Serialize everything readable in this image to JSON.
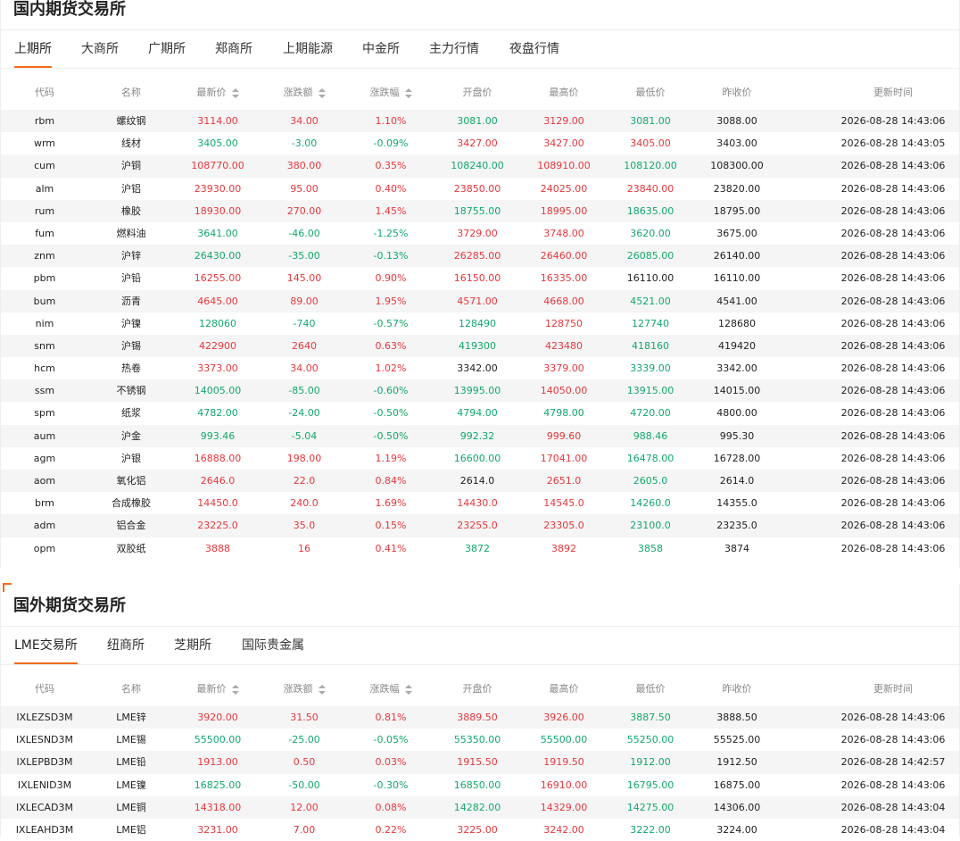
{
  "domestic": {
    "title": "国内期货交易所",
    "tabs": [
      "上期所",
      "大商所",
      "广期所",
      "郑商所",
      "上期能源",
      "中金所",
      "主力行情",
      "夜盘行情"
    ],
    "active_tab": 0,
    "headers": [
      "代码",
      "名称",
      "最新价",
      "涨跌额",
      "涨跌幅",
      "开盘价",
      "最高价",
      "最低价",
      "昨收价",
      "更新时间"
    ],
    "rows": [
      {
        "code": "rbm",
        "name": "螺纹钢",
        "last": "3114.00",
        "chg": "34.00",
        "pct": "1.10%",
        "open": "3081.00",
        "high": "3129.00",
        "low": "3081.00",
        "prev": "3088.00",
        "time": "2026-08-28 14:43:06",
        "c": [
          "up",
          "up",
          "up",
          "down",
          "up",
          "down"
        ]
      },
      {
        "code": "wrm",
        "name": "线材",
        "last": "3405.00",
        "chg": "-3.00",
        "pct": "-0.09%",
        "open": "3427.00",
        "high": "3427.00",
        "low": "3405.00",
        "prev": "3403.00",
        "time": "2026-08-28 14:43:05",
        "c": [
          "down",
          "down",
          "down",
          "up",
          "up",
          "up"
        ]
      },
      {
        "code": "cum",
        "name": "沪铜",
        "last": "108770.00",
        "chg": "380.00",
        "pct": "0.35%",
        "open": "108240.00",
        "high": "108910.00",
        "low": "108120.00",
        "prev": "108300.00",
        "time": "2026-08-28 14:43:06",
        "c": [
          "up",
          "up",
          "up",
          "down",
          "up",
          "down"
        ]
      },
      {
        "code": "alm",
        "name": "沪铝",
        "last": "23930.00",
        "chg": "95.00",
        "pct": "0.40%",
        "open": "23850.00",
        "high": "24025.00",
        "low": "23840.00",
        "prev": "23820.00",
        "time": "2026-08-28 14:43:06",
        "c": [
          "up",
          "up",
          "up",
          "up",
          "up",
          "up"
        ]
      },
      {
        "code": "rum",
        "name": "橡胶",
        "last": "18930.00",
        "chg": "270.00",
        "pct": "1.45%",
        "open": "18755.00",
        "high": "18995.00",
        "low": "18635.00",
        "prev": "18795.00",
        "time": "2026-08-28 14:43:06",
        "c": [
          "up",
          "up",
          "up",
          "down",
          "up",
          "down"
        ]
      },
      {
        "code": "fum",
        "name": "燃料油",
        "last": "3641.00",
        "chg": "-46.00",
        "pct": "-1.25%",
        "open": "3729.00",
        "high": "3748.00",
        "low": "3620.00",
        "prev": "3675.00",
        "time": "2026-08-28 14:43:06",
        "c": [
          "down",
          "down",
          "down",
          "up",
          "up",
          "down"
        ]
      },
      {
        "code": "znm",
        "name": "沪锌",
        "last": "26430.00",
        "chg": "-35.00",
        "pct": "-0.13%",
        "open": "26285.00",
        "high": "26460.00",
        "low": "26085.00",
        "prev": "26140.00",
        "time": "2026-08-28 14:43:06",
        "c": [
          "down",
          "down",
          "down",
          "up",
          "up",
          "down"
        ]
      },
      {
        "code": "pbm",
        "name": "沪铅",
        "last": "16255.00",
        "chg": "145.00",
        "pct": "0.90%",
        "open": "16150.00",
        "high": "16335.00",
        "low": "16110.00",
        "prev": "16110.00",
        "time": "2026-08-28 14:43:06",
        "c": [
          "up",
          "up",
          "up",
          "up",
          "up",
          "flat"
        ]
      },
      {
        "code": "bum",
        "name": "沥青",
        "last": "4645.00",
        "chg": "89.00",
        "pct": "1.95%",
        "open": "4571.00",
        "high": "4668.00",
        "low": "4521.00",
        "prev": "4541.00",
        "time": "2026-08-28 14:43:06",
        "c": [
          "up",
          "up",
          "up",
          "up",
          "up",
          "down"
        ]
      },
      {
        "code": "nim",
        "name": "沪镍",
        "last": "128060",
        "chg": "-740",
        "pct": "-0.57%",
        "open": "128490",
        "high": "128750",
        "low": "127740",
        "prev": "128680",
        "time": "2026-08-28 14:43:06",
        "c": [
          "down",
          "down",
          "down",
          "down",
          "up",
          "down"
        ]
      },
      {
        "code": "snm",
        "name": "沪锡",
        "last": "422900",
        "chg": "2640",
        "pct": "0.63%",
        "open": "419300",
        "high": "423480",
        "low": "418160",
        "prev": "419420",
        "time": "2026-08-28 14:43:06",
        "c": [
          "up",
          "up",
          "up",
          "down",
          "up",
          "down"
        ]
      },
      {
        "code": "hcm",
        "name": "热卷",
        "last": "3373.00",
        "chg": "34.00",
        "pct": "1.02%",
        "open": "3342.00",
        "high": "3379.00",
        "low": "3339.00",
        "prev": "3342.00",
        "time": "2026-08-28 14:43:06",
        "c": [
          "up",
          "up",
          "up",
          "flat",
          "up",
          "down"
        ]
      },
      {
        "code": "ssm",
        "name": "不锈钢",
        "last": "14005.00",
        "chg": "-85.00",
        "pct": "-0.60%",
        "open": "13995.00",
        "high": "14050.00",
        "low": "13915.00",
        "prev": "14015.00",
        "time": "2026-08-28 14:43:06",
        "c": [
          "down",
          "down",
          "down",
          "down",
          "up",
          "down"
        ]
      },
      {
        "code": "spm",
        "name": "纸浆",
        "last": "4782.00",
        "chg": "-24.00",
        "pct": "-0.50%",
        "open": "4794.00",
        "high": "4798.00",
        "low": "4720.00",
        "prev": "4800.00",
        "time": "2026-08-28 14:43:06",
        "c": [
          "down",
          "down",
          "down",
          "down",
          "down",
          "down"
        ]
      },
      {
        "code": "aum",
        "name": "沪金",
        "last": "993.46",
        "chg": "-5.04",
        "pct": "-0.50%",
        "open": "992.32",
        "high": "999.60",
        "low": "988.46",
        "prev": "995.30",
        "time": "2026-08-28 14:43:06",
        "c": [
          "down",
          "down",
          "down",
          "down",
          "up",
          "down"
        ]
      },
      {
        "code": "agm",
        "name": "沪银",
        "last": "16888.00",
        "chg": "198.00",
        "pct": "1.19%",
        "open": "16600.00",
        "high": "17041.00",
        "low": "16478.00",
        "prev": "16728.00",
        "time": "2026-08-28 14:43:06",
        "c": [
          "up",
          "up",
          "up",
          "down",
          "up",
          "down"
        ]
      },
      {
        "code": "aom",
        "name": "氧化铝",
        "last": "2646.0",
        "chg": "22.0",
        "pct": "0.84%",
        "open": "2614.0",
        "high": "2651.0",
        "low": "2605.0",
        "prev": "2614.0",
        "time": "2026-08-28 14:43:06",
        "c": [
          "up",
          "up",
          "up",
          "flat",
          "up",
          "down"
        ]
      },
      {
        "code": "brm",
        "name": "合成橡胶",
        "last": "14450.0",
        "chg": "240.0",
        "pct": "1.69%",
        "open": "14430.0",
        "high": "14545.0",
        "low": "14260.0",
        "prev": "14355.0",
        "time": "2026-08-28 14:43:06",
        "c": [
          "up",
          "up",
          "up",
          "up",
          "up",
          "down"
        ]
      },
      {
        "code": "adm",
        "name": "铝合金",
        "last": "23225.0",
        "chg": "35.0",
        "pct": "0.15%",
        "open": "23255.0",
        "high": "23305.0",
        "low": "23100.0",
        "prev": "23235.0",
        "time": "2026-08-28 14:43:06",
        "c": [
          "up",
          "up",
          "up",
          "up",
          "up",
          "down"
        ]
      },
      {
        "code": "opm",
        "name": "双胶纸",
        "last": "3888",
        "chg": "16",
        "pct": "0.41%",
        "open": "3872",
        "high": "3892",
        "low": "3858",
        "prev": "3874",
        "time": "2026-08-28 14:43:06",
        "c": [
          "up",
          "up",
          "up",
          "down",
          "up",
          "down"
        ]
      }
    ]
  },
  "foreign": {
    "title": "国外期货交易所",
    "tabs": [
      "LME交易所",
      "纽商所",
      "芝期所",
      "国际贵金属"
    ],
    "active_tab": 0,
    "headers": [
      "代码",
      "名称",
      "最新价",
      "涨跌额",
      "涨跌幅",
      "开盘价",
      "最高价",
      "最低价",
      "昨收价",
      "更新时间"
    ],
    "rows": [
      {
        "code": "IXLEZSD3M",
        "name": "LME锌",
        "last": "3920.00",
        "chg": "31.50",
        "pct": "0.81%",
        "open": "3889.50",
        "high": "3926.00",
        "low": "3887.50",
        "prev": "3888.50",
        "time": "2026-08-28 14:43:06",
        "c": [
          "up",
          "up",
          "up",
          "up",
          "up",
          "down"
        ]
      },
      {
        "code": "IXLESND3M",
        "name": "LME锡",
        "last": "55500.00",
        "chg": "-25.00",
        "pct": "-0.05%",
        "open": "55350.00",
        "high": "55500.00",
        "low": "55250.00",
        "prev": "55525.00",
        "time": "2026-08-28 14:43:06",
        "c": [
          "down",
          "down",
          "down",
          "down",
          "down",
          "down"
        ]
      },
      {
        "code": "IXLEPBD3M",
        "name": "LME铅",
        "last": "1913.00",
        "chg": "0.50",
        "pct": "0.03%",
        "open": "1915.50",
        "high": "1919.50",
        "low": "1912.00",
        "prev": "1912.50",
        "time": "2026-08-28 14:42:57",
        "c": [
          "up",
          "up",
          "up",
          "up",
          "up",
          "down"
        ]
      },
      {
        "code": "IXLENID3M",
        "name": "LME镍",
        "last": "16825.00",
        "chg": "-50.00",
        "pct": "-0.30%",
        "open": "16850.00",
        "high": "16910.00",
        "low": "16795.00",
        "prev": "16875.00",
        "time": "2026-08-28 14:43:06",
        "c": [
          "down",
          "down",
          "down",
          "down",
          "up",
          "down"
        ]
      },
      {
        "code": "IXLECAD3M",
        "name": "LME铜",
        "last": "14318.00",
        "chg": "12.00",
        "pct": "0.08%",
        "open": "14282.00",
        "high": "14329.00",
        "low": "14275.00",
        "prev": "14306.00",
        "time": "2026-08-28 14:43:04",
        "c": [
          "up",
          "up",
          "up",
          "down",
          "up",
          "down"
        ]
      },
      {
        "code": "IXLEAHD3M",
        "name": "LME铝",
        "last": "3231.00",
        "chg": "7.00",
        "pct": "0.22%",
        "open": "3225.00",
        "high": "3242.00",
        "low": "3222.00",
        "prev": "3224.00",
        "time": "2026-08-28 14:43:04",
        "c": [
          "up",
          "up",
          "up",
          "up",
          "up",
          "down"
        ]
      }
    ]
  },
  "colors": {
    "up": "#e8363b",
    "down": "#11a86b",
    "accent": "#f26b1d"
  }
}
